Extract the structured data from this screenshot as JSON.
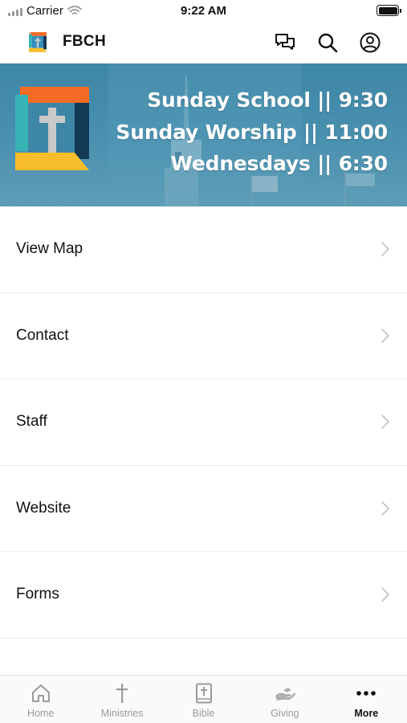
{
  "status_bar": {
    "carrier": "Carrier",
    "time": "9:22 AM"
  },
  "header": {
    "title": "FBCH",
    "icons": [
      "chat-icon",
      "search-icon",
      "profile-icon"
    ]
  },
  "banner": {
    "lines": [
      "Sunday School || 9:30",
      "Sunday Worship || 11:00",
      "Wednesdays || 6:30"
    ]
  },
  "menu": {
    "items": [
      {
        "label": "View Map"
      },
      {
        "label": "Contact"
      },
      {
        "label": "Staff"
      },
      {
        "label": "Website"
      },
      {
        "label": "Forms"
      }
    ]
  },
  "tab_bar": {
    "tabs": [
      {
        "label": "Home",
        "icon": "home-icon"
      },
      {
        "label": "Ministries",
        "icon": "cross-icon"
      },
      {
        "label": "Bible",
        "icon": "bible-icon"
      },
      {
        "label": "Giving",
        "icon": "giving-hand-icon"
      },
      {
        "label": "More",
        "icon": "more-dots-icon"
      }
    ],
    "active": "More"
  },
  "colors": {
    "banner": "#4a91b0",
    "logo_orange": "#f36b24",
    "logo_teal": "#37b3b6",
    "logo_navy": "#123a57",
    "logo_yellow": "#f8bd2b"
  }
}
